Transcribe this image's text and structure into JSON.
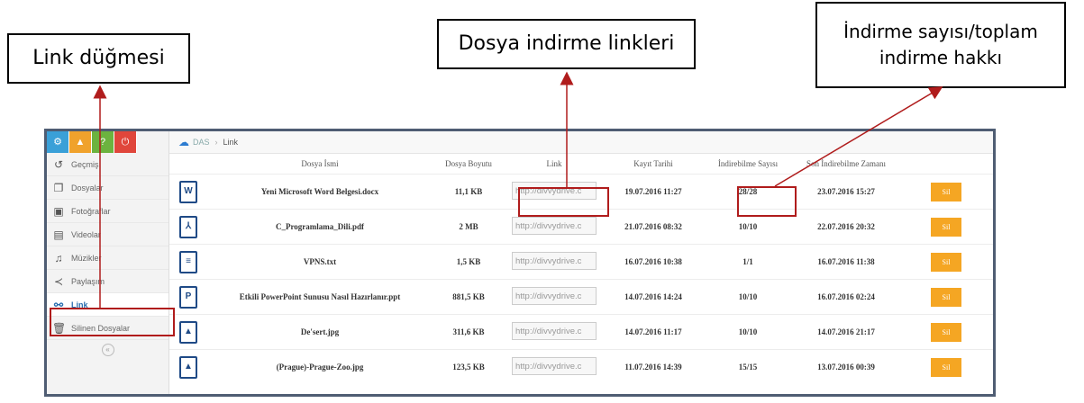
{
  "callouts": {
    "link_button": "Link düğmesi",
    "file_links": "Dosya indirme linkleri",
    "download_count_line1": "İndirme sayısı/toplam",
    "download_count_line2": "indirme hakkı"
  },
  "colors": {
    "accent_red": "#b01c1c",
    "button_orange": "#f5a623",
    "frame": "#4f5d73"
  },
  "toolbar": {
    "buttons": [
      "settings-icon",
      "warning-icon",
      "help-icon",
      "power-icon"
    ]
  },
  "sidebar": {
    "items": [
      {
        "label": "Geçmiş",
        "icon": "history-icon"
      },
      {
        "label": "Dosyalar",
        "icon": "files-icon"
      },
      {
        "label": "Fotoğraflar",
        "icon": "photos-icon"
      },
      {
        "label": "Videolar",
        "icon": "video-icon"
      },
      {
        "label": "Müzikler",
        "icon": "music-icon"
      },
      {
        "label": "Paylaşım",
        "icon": "share-icon"
      },
      {
        "label": "Link",
        "icon": "link-icon"
      },
      {
        "label": "Silinen Dosyalar",
        "icon": "trash-icon"
      }
    ]
  },
  "breadcrumb": {
    "root": "DAS",
    "current": "Link"
  },
  "table": {
    "headers": [
      "Dosya İsmi",
      "Dosya Boyutu",
      "Link",
      "Kayıt Tarihi",
      "İndirebilme Sayısı",
      "Son İndirebilme Zamanı"
    ],
    "link_text": "http://divvydrive.c",
    "action_label": "Sil",
    "rows": [
      {
        "icon": "word-file-icon",
        "name": "Yeni Microsoft Word Belgesi.docx",
        "size": "11,1 KB",
        "date": "19.07.2016 11:27",
        "count": "28/28",
        "last": "23.07.2016 15:27"
      },
      {
        "icon": "pdf-file-icon",
        "name": "C_Programlama_Dili.pdf",
        "size": "2 MB",
        "date": "21.07.2016 08:32",
        "count": "10/10",
        "last": "22.07.2016 20:32"
      },
      {
        "icon": "text-file-icon",
        "name": "VPNS.txt",
        "size": "1,5 KB",
        "date": "16.07.2016 10:38",
        "count": "1/1",
        "last": "16.07.2016 11:38"
      },
      {
        "icon": "ppt-file-icon",
        "name": "Etkili PowerPoint Sunusu Nasıl Hazırlanır.ppt",
        "size": "881,5 KB",
        "date": "14.07.2016 14:24",
        "count": "10/10",
        "last": "16.07.2016 02:24"
      },
      {
        "icon": "image-file-icon",
        "name": "De'sert.jpg",
        "size": "311,6 KB",
        "date": "14.07.2016 11:17",
        "count": "10/10",
        "last": "14.07.2016 21:17"
      },
      {
        "icon": "image-file-icon",
        "name": "(Prague)-Prague-Zoo.jpg",
        "size": "123,5 KB",
        "date": "11.07.2016 14:39",
        "count": "15/15",
        "last": "13.07.2016 00:39"
      }
    ]
  }
}
